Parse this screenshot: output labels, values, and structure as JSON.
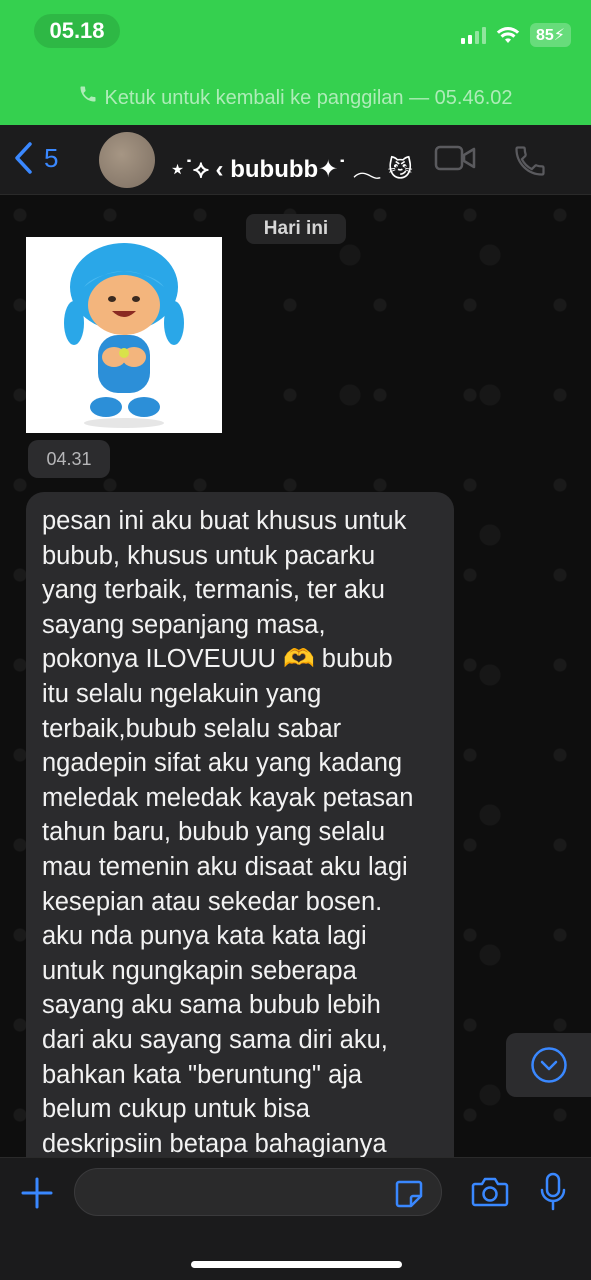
{
  "status_bar": {
    "time": "05.18",
    "battery": "85"
  },
  "call_banner": {
    "text": "Ketuk untuk kembali ke panggilan — 05.46.02"
  },
  "header": {
    "back_count": "5",
    "contact_name": "⋆˙⟡ ‹ bububb✦˙ 𓂃 😼"
  },
  "chat": {
    "date_chip": "Hari ini",
    "sticker_time": "04.31",
    "message_lines": [
      "pesan ini aku buat khusus untuk",
      "bubub, khusus untuk pacarku",
      "yang terbaik, termanis, ter aku",
      "sayang sepanjang masa,",
      "pokonya ILOVEUUU 🫶 bubub",
      "itu selalu ngelakuin yang",
      "terbaik,bubub selalu sabar",
      "ngadepin sifat aku yang kadang",
      "meledak meledak kayak petasan",
      "tahun baru, bubub yang selalu",
      "mau temenin aku disaat aku lagi",
      "kesepian atau sekedar bosen.",
      "aku nda punya kata kata lagi",
      "untuk ngungkapin seberapa",
      "sayang aku sama bubub lebih",
      "dari aku sayang sama diri aku,",
      "bahkan kata \"beruntung\" aja",
      "belum cukup untuk bisa",
      "deskripsiin betapa bahagianya"
    ]
  },
  "composer": {
    "input_value": "",
    "input_placeholder": ""
  },
  "icons": {
    "back": "chevron-left-icon",
    "video": "video-camera-icon",
    "call": "phone-icon",
    "plus": "plus-icon",
    "sticker": "sticker-icon",
    "camera": "camera-icon",
    "mic": "microphone-icon",
    "scroll": "chevron-down-circle-icon"
  },
  "colors": {
    "call_banner": "#35d04f",
    "accent_blue": "#3a88ff",
    "bubble": "#2b2b2d"
  }
}
